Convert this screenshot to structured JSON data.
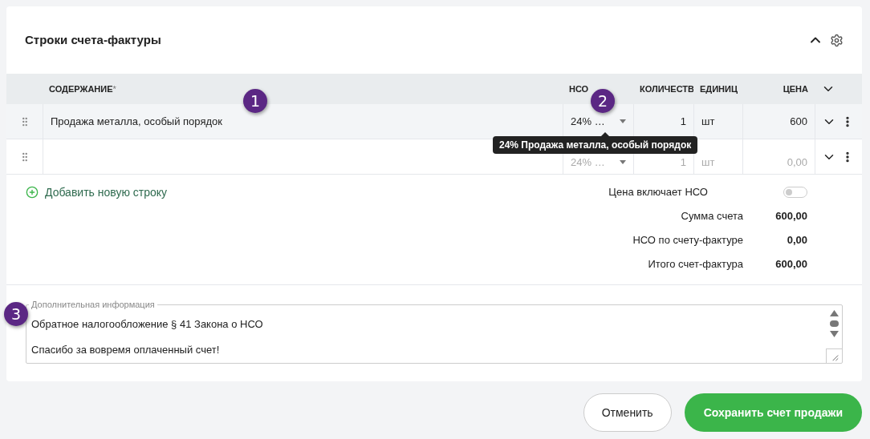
{
  "section": {
    "title": "Строки счета-фактуры",
    "expanded": true
  },
  "table": {
    "columns": [
      {
        "label": "СОДЕРЖАНИЕ",
        "required_mark": "*"
      },
      {
        "label": "НСО"
      },
      {
        "label": "КОЛИЧЕСТВ"
      },
      {
        "label": "ЕДИНИЦ"
      },
      {
        "label": "ЦЕНА"
      }
    ],
    "rows": [
      {
        "content": "Продажа металла, особый порядок",
        "vat": "24% …",
        "quantity": "1",
        "unit": "шт",
        "price": "600",
        "placeholder": false,
        "highlighted": true
      },
      {
        "content": "",
        "vat": "24% …",
        "quantity": "1",
        "unit": "шт",
        "price": "0,00",
        "placeholder": true,
        "highlighted": false
      }
    ]
  },
  "tooltip": "24% Продажа металла, особый порядок",
  "add_row": "Добавить новую строку",
  "price_includes_vat": {
    "label": "Цена включает НСО",
    "on": false
  },
  "totals": [
    {
      "label": "Сумма счета",
      "value": "600,00"
    },
    {
      "label": "НСО по счету-фактуре",
      "value": "0,00"
    },
    {
      "label": "Итого счет-фактура",
      "value": "600,00"
    }
  ],
  "notes": {
    "label": "Дополнительная информация",
    "value": "Обратное налогообложение § 41 Закона о НСО\n\nСпасибо за вовремя оплаченный счет!"
  },
  "callouts": [
    "1",
    "2",
    "3"
  ],
  "buttons": [
    {
      "label": "Отменить",
      "kind": "secondary"
    },
    {
      "label": "Сохранить счет продажи",
      "kind": "primary"
    }
  ]
}
